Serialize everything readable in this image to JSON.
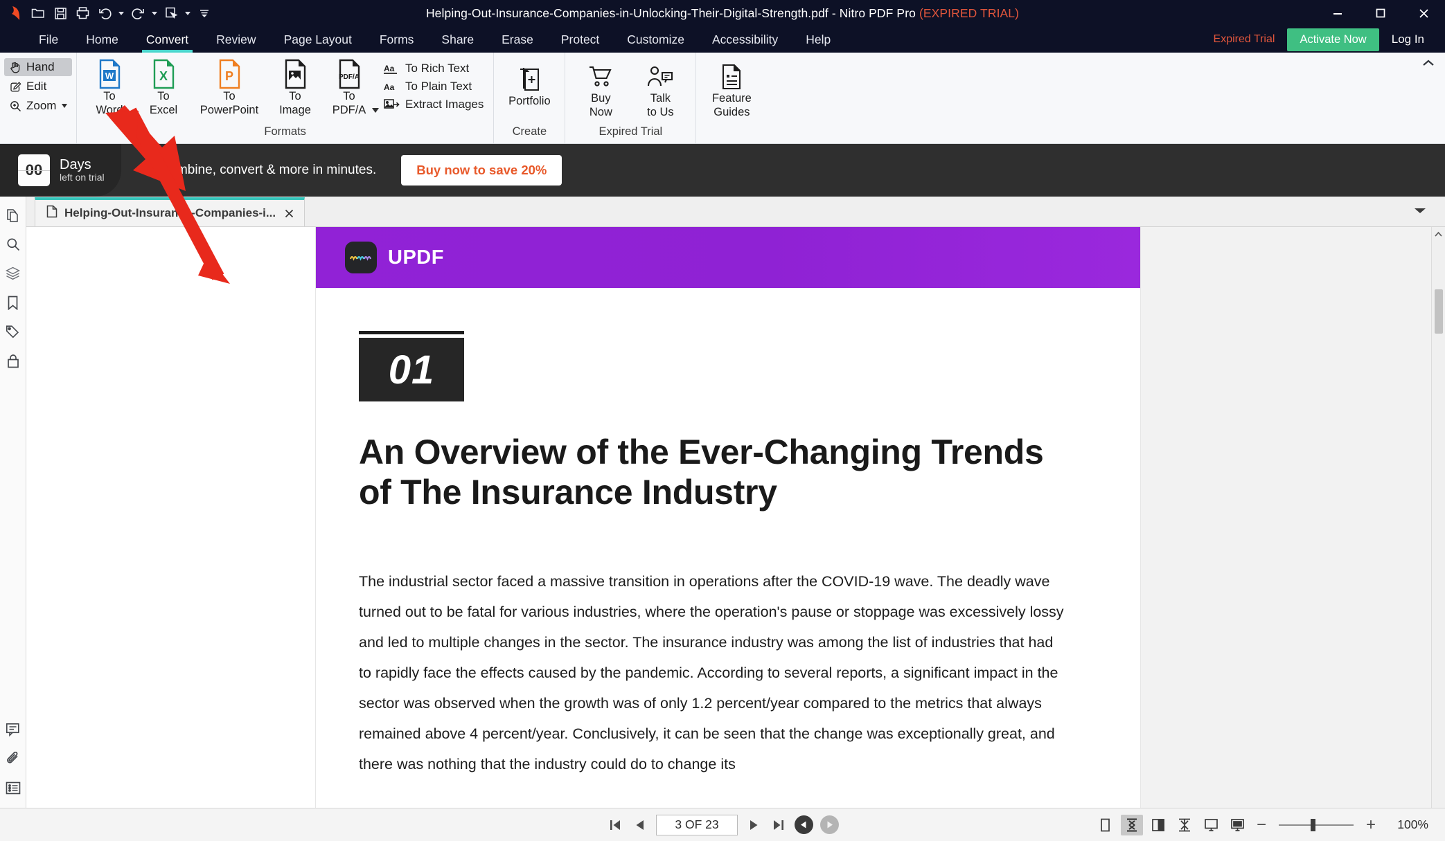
{
  "titlebar": {
    "document_name": "Helping-Out-Insurance-Companies-in-Unlocking-Their-Digital-Strength.pdf",
    "separator": " - ",
    "app_name": "Nitro PDF Pro",
    "trial_status": "(EXPIRED TRIAL)",
    "quick_access": [
      {
        "name": "nitro-logo-icon",
        "label": "Nitro"
      },
      {
        "name": "open-icon",
        "label": "Open"
      },
      {
        "name": "save-icon",
        "label": "Save"
      },
      {
        "name": "print-icon",
        "label": "Print"
      },
      {
        "name": "undo-icon",
        "label": "Undo"
      },
      {
        "name": "redo-icon",
        "label": "Redo"
      },
      {
        "name": "select-icon",
        "label": "Select"
      },
      {
        "name": "customize-qat-icon",
        "label": "Customize Quick Access Toolbar"
      }
    ],
    "window_controls": {
      "minimize": "Minimize",
      "maximize": "Maximize",
      "close": "Close"
    }
  },
  "menubar": {
    "tabs": [
      {
        "label": "File",
        "active": false
      },
      {
        "label": "Home",
        "active": false
      },
      {
        "label": "Convert",
        "active": true
      },
      {
        "label": "Review",
        "active": false
      },
      {
        "label": "Page Layout",
        "active": false
      },
      {
        "label": "Forms",
        "active": false
      },
      {
        "label": "Share",
        "active": false
      },
      {
        "label": "Erase",
        "active": false
      },
      {
        "label": "Protect",
        "active": false
      },
      {
        "label": "Customize",
        "active": false
      },
      {
        "label": "Accessibility",
        "active": false
      },
      {
        "label": "Help",
        "active": false
      }
    ],
    "expired_trial_label": "Expired Trial",
    "activate_button": "Activate Now",
    "login_label": "Log In",
    "accent_color": "#4ad6cd",
    "activate_color": "#3fbf82",
    "expired_color": "#e2563c"
  },
  "ribbon": {
    "tools": [
      {
        "label": "Hand",
        "icon": "hand-icon",
        "selected": true,
        "caret": false
      },
      {
        "label": "Edit",
        "icon": "edit-icon",
        "selected": false,
        "caret": false
      },
      {
        "label": "Zoom",
        "icon": "zoom-magnifier-icon",
        "selected": false,
        "caret": true
      }
    ],
    "formats": {
      "group_label": "Formats",
      "buttons": [
        {
          "line1": "To",
          "line2": "Word",
          "icon": "word-file-icon",
          "color": "#1f78c8"
        },
        {
          "line1": "To",
          "line2": "Excel",
          "icon": "excel-file-icon",
          "color": "#1f9d55"
        },
        {
          "line1": "To",
          "line2": "PowerPoint",
          "icon": "powerpoint-file-icon",
          "color": "#ef7e20"
        },
        {
          "line1": "To",
          "line2": "Image",
          "icon": "image-file-icon",
          "color": "#1d1d1d"
        },
        {
          "line1": "To",
          "line2": "PDF/A",
          "icon": "pdfa-file-icon",
          "color": "#1d1d1d",
          "caret": true
        }
      ],
      "text_ops": [
        {
          "label": "To Rich Text",
          "icon": "rich-text-icon"
        },
        {
          "label": "To Plain Text",
          "icon": "plain-text-icon"
        },
        {
          "label": "Extract Images",
          "icon": "extract-images-icon"
        }
      ]
    },
    "create": {
      "group_label": "Create",
      "buttons": [
        {
          "line1": "Portfolio",
          "line2": "",
          "icon": "portfolio-icon"
        }
      ]
    },
    "expired_trial_group": {
      "group_label": "Expired Trial",
      "buttons": [
        {
          "line1": "Buy",
          "line2": "Now",
          "icon": "cart-icon"
        },
        {
          "line1": "Talk",
          "line2": "to Us",
          "icon": "talk-to-us-icon"
        }
      ]
    },
    "help_group": {
      "group_label": "",
      "buttons": [
        {
          "line1": "Feature",
          "line2": "Guides",
          "icon": "feature-guides-icon"
        }
      ]
    },
    "collapse_icon": "chevron-up-icon"
  },
  "banner": {
    "days_count": "00",
    "days_label": "Days",
    "days_sub": "left on trial",
    "message": "lit, combine, convert & more in minutes.",
    "buy_button": "Buy now to save 20%",
    "background": "#2f2f2f",
    "buy_color": "#e8592a"
  },
  "left_rail": {
    "top_icons": [
      {
        "name": "pages-thumbnails-icon",
        "label": "Page Thumbnails"
      },
      {
        "name": "search-icon",
        "label": "Search"
      },
      {
        "name": "layers-icon",
        "label": "Layers"
      },
      {
        "name": "bookmarks-icon",
        "label": "Bookmarks"
      },
      {
        "name": "tags-icon",
        "label": "Tags"
      },
      {
        "name": "security-lock-icon",
        "label": "Security"
      }
    ],
    "bottom_icons": [
      {
        "name": "comments-icon",
        "label": "Comments"
      },
      {
        "name": "attachments-icon",
        "label": "Attachments"
      },
      {
        "name": "properties-icon",
        "label": "Properties"
      }
    ]
  },
  "tabstrip": {
    "tab_label": "Helping-Out-Insurance-Companies-i...",
    "file_icon": "file-icon",
    "close_icon": "close-icon",
    "accent_color": "#37c5bb"
  },
  "document": {
    "header": {
      "brand": "UPDF",
      "brand_icon": "updf-logo-icon",
      "background": "#9122d6"
    },
    "section_number": "01",
    "title": "An Overview of the Ever-Changing Trends of The Insurance Industry",
    "paragraph": "The industrial sector faced a massive transition in operations after the COVID-19 wave. The deadly wave turned out to be fatal for various industries, where the operation's pause or stoppage was excessively lossy and led to multiple changes in the sector. The insurance industry was among the list of industries that had to rapidly face the effects caused by the pandemic. According to several reports, a significant impact in the sector was observed when the growth was of only 1.2 percent/year compared to the metrics that always remained above 4 percent/year. Conclusively, it can be seen that the change was exceptionally great, and there was nothing that the industry could do to change its"
  },
  "statusbar": {
    "first_page_icon": "first-page-icon",
    "prev_page_icon": "previous-page-icon",
    "page_indicator": "3 OF 23",
    "current_page": 3,
    "total_pages": 23,
    "next_page_icon": "next-page-icon",
    "last_page_icon": "last-page-icon",
    "prev_view_icon": "previous-view-icon",
    "next_view_icon": "next-view-icon",
    "view_modes": [
      {
        "name": "single-page-view-icon",
        "label": "Single Page",
        "selected": false
      },
      {
        "name": "continuous-view-icon",
        "label": "Continuous",
        "selected": true
      },
      {
        "name": "two-page-view-icon",
        "label": "Two Pages",
        "selected": false
      },
      {
        "name": "two-page-continuous-view-icon",
        "label": "Two Page Continuous",
        "selected": false
      },
      {
        "name": "fit-page-icon",
        "label": "Fit Page",
        "selected": false
      },
      {
        "name": "presentation-mode-icon",
        "label": "Presentation Mode",
        "selected": false
      }
    ],
    "zoom_out": "−",
    "zoom_in": "+",
    "zoom_level": "100%"
  },
  "annotation": {
    "arrow_color": "#e8291c",
    "description": "red-arrow-pointing-to-to-word-button"
  }
}
